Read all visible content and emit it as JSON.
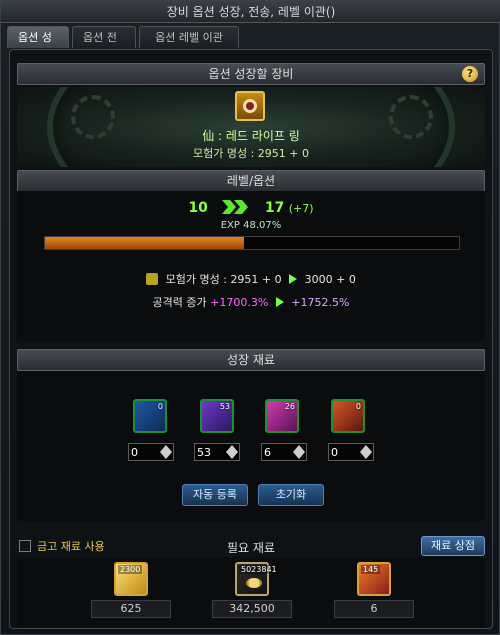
{
  "window": {
    "title": "장비 옵션 성장, 전송, 레벨 이관()"
  },
  "tabs": [
    {
      "label": "옵션 성장",
      "active": true
    },
    {
      "label": "옵션 전송",
      "active": false
    },
    {
      "label": "옵션 레벨 이관",
      "active": false
    }
  ],
  "equipment": {
    "header": "옵션 성장할 장비",
    "help_label": "?",
    "item_name": "仙 : 레드 라이프 링",
    "fame": "모험가 명성 : 2951 + 0"
  },
  "level": {
    "header": "레벨/옵션",
    "from": "10",
    "to": "17",
    "bonus": "(+7)",
    "exp_text": "EXP 48.07%",
    "exp_progress": 0.4807,
    "stat_fame": {
      "prefix": "모험가 명성 : ",
      "from": "2951 + 0",
      "to": "3000 + 0"
    },
    "stat_attack": {
      "prefix": "공격력 증가 ",
      "from": "+1700.3%",
      "to": "+1752.5%"
    }
  },
  "materials": {
    "header": "성장 재료",
    "items": [
      {
        "count_badge": "0",
        "value": "0",
        "icon": "blue-material-icon"
      },
      {
        "count_badge": "53",
        "value": "53",
        "icon": "purple-material-icon"
      },
      {
        "count_badge": "26",
        "value": "6",
        "icon": "pink-material-icon"
      },
      {
        "count_badge": "0",
        "value": "0",
        "icon": "orange-material-icon"
      }
    ],
    "auto_register_label": "자동 등록",
    "reset_label": "초기화"
  },
  "required": {
    "use_gold_label": "금고 재료 사용",
    "title": "필요 재료",
    "shop_label": "재료 상점",
    "items": [
      {
        "badge": "2300",
        "value": "625",
        "icon": "gold-crystal-icon"
      },
      {
        "badge": "5023841",
        "value": "342,500",
        "icon": "gold-coins-icon"
      },
      {
        "badge": "145",
        "value": "6",
        "icon": "fire-material-icon"
      }
    ]
  },
  "colors": {
    "accent_green": "#8cff3d",
    "progress_orange": "#e5861f",
    "button_blue": "#2b5c94",
    "magenta": "#ff69ff"
  }
}
